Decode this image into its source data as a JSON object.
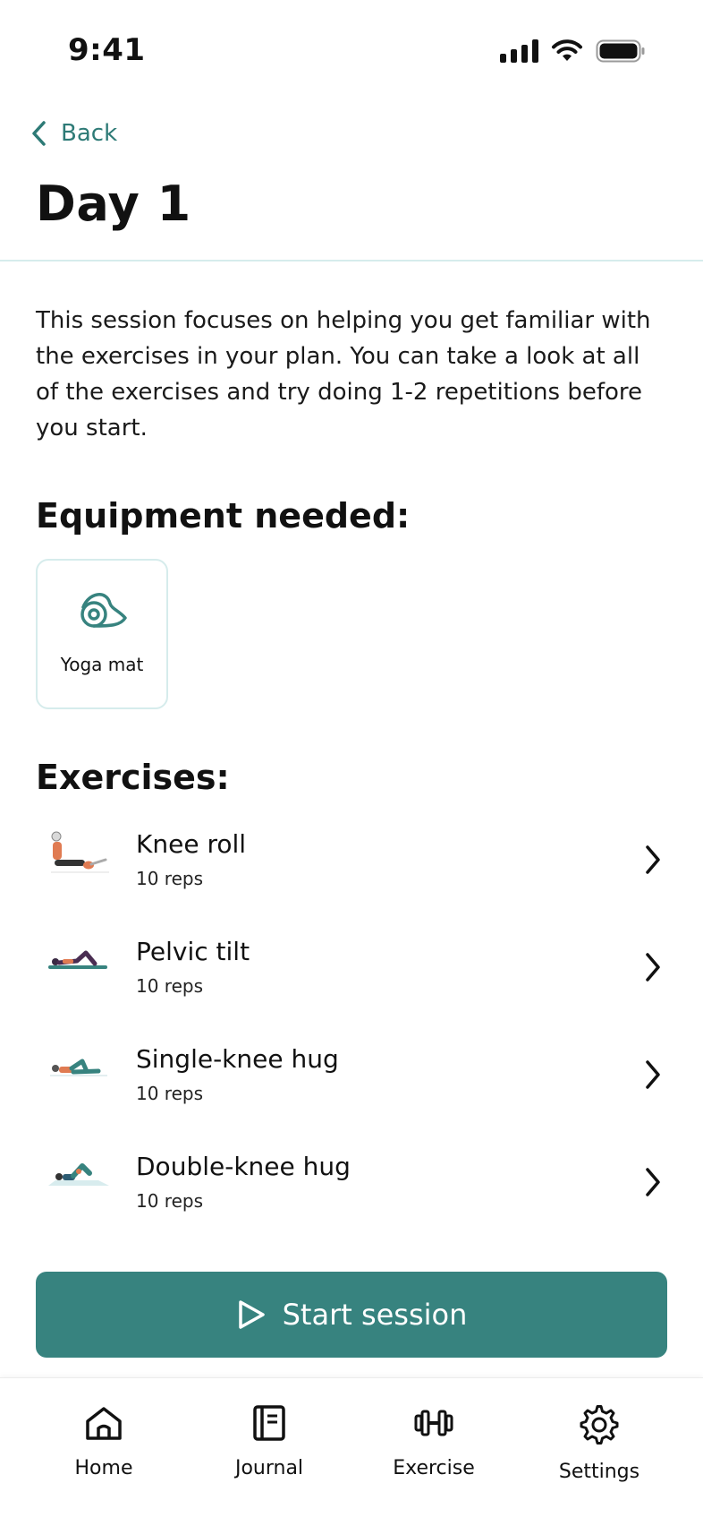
{
  "status_bar": {
    "time": "9:41"
  },
  "header": {
    "back_label": "Back",
    "title": "Day 1"
  },
  "description": "This session focuses on helping you get familiar with the exercises in your plan. You can take a look at all of the exercises and try doing 1-2 repetitions before you start.",
  "equipment": {
    "heading": "Equipment needed:",
    "items": [
      {
        "label": "Yoga mat",
        "icon": "yoga-mat-icon"
      }
    ]
  },
  "exercises": {
    "heading": "Exercises:",
    "items": [
      {
        "name": "Knee roll",
        "reps": "10 reps"
      },
      {
        "name": "Pelvic tilt",
        "reps": "10 reps"
      },
      {
        "name": "Single-knee hug",
        "reps": "10 reps"
      },
      {
        "name": "Double-knee hug",
        "reps": "10 reps"
      }
    ]
  },
  "start_button": {
    "label": "Start session",
    "icon": "play-icon"
  },
  "tab_bar": {
    "tabs": [
      {
        "label": "Home",
        "icon": "home-icon"
      },
      {
        "label": "Journal",
        "icon": "journal-icon"
      },
      {
        "label": "Exercise",
        "icon": "dumbbell-icon"
      },
      {
        "label": "Settings",
        "icon": "gear-icon"
      }
    ]
  },
  "colors": {
    "accent": "#37837f",
    "link": "#2d7a76",
    "divider": "#d6ecec"
  }
}
